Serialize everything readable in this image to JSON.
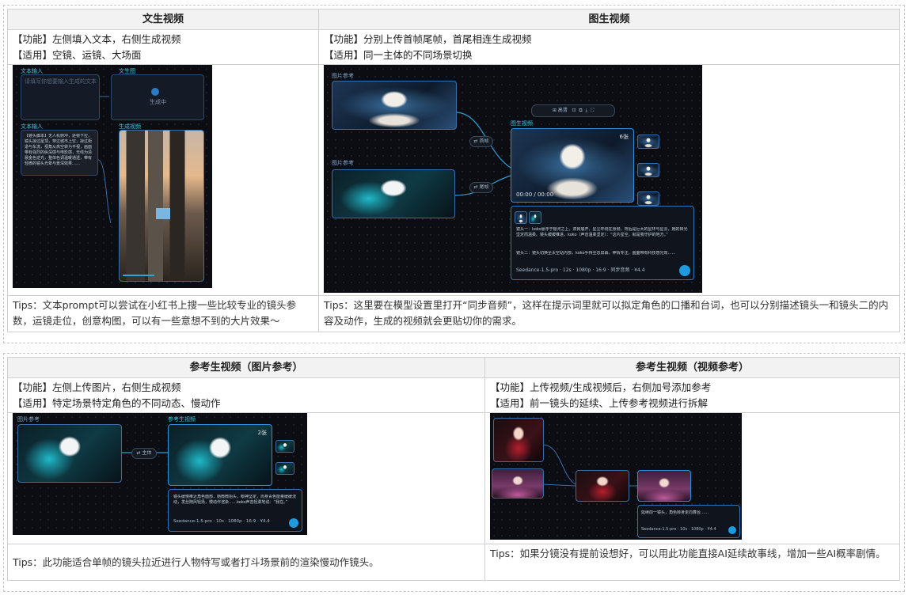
{
  "section1": {
    "left": {
      "title": "文生视频",
      "function_line": "【功能】左侧填入文本，右侧生成视频",
      "usage_line": "【适用】空镜、运镜、大场面",
      "tip": "Tips：文本prompt可以尝试在小红书上搜一些比较专业的镜头参数，运镜走位，创意构图，可以有一些意想不到的大片效果～",
      "shot": {
        "label_text_input": "文本输入",
        "label_text_gen": "文生图",
        "label_text_node": "文本输入",
        "label_video": "生成视频",
        "placeholder": "请填写你想要输入生成的文本",
        "gen_caption": "生成中",
        "prompt_text": "【镜头脚本】无人机俯冲，逐帧下拉，镜头掠过屋顶，穿过城市上空，掠过街道与车流，视角从高空转为平视，画面带有强烈的纵深感与电影感，光线为清晨金色逆光，整体色调温暖通透，带有轻微的镜头光晕与景深效果……"
      }
    },
    "right": {
      "title": "图生视频",
      "function_line": "【功能】分别上传首帧尾帧，首尾相连生成视频",
      "usage_line": "【适用】同一主体的不同场景切换",
      "tip": "Tips：这里要在模型设置里打开“同步音频”，这样在提示词里就可以拟定角色的口播和台词，也可以分别描述镜头一和镜头二的内容及动作，生成的视频就会更贴切你的需求。",
      "shot": {
        "label_ref1": "图片参考",
        "label_ref2": "图片参考",
        "label_video": "图生视频",
        "tag_first": "⇄ 首帧",
        "tag_last": "⇄ 尾帧",
        "toolbar": [
          "⊞ 高清",
          "⊡",
          "⧉",
          "⤓",
          "⛶"
        ],
        "count": "6张",
        "time": "00:00 / 00:00",
        "prompt_1": "镜头一：koko悬浮于银河之上，双臂展开，星尘环绕在身侧，背后是巨大的星环与星云，她的目光坚定而温柔。镜头缓缓推进。koko（声音温柔坚定）：“这片星空，就是我守护的地方。”",
        "prompt_2": "镜头二：镜头切换至太空站内部，koko手持全息屏幕，神情专注，画面带有科技感光效……",
        "model": "Seedance-1.5-pro",
        "duration": "12s",
        "resolution": "1080p",
        "ratio": "16:9",
        "audio": "同步音频",
        "cost": "¥4.4"
      }
    }
  },
  "section2": {
    "left": {
      "title": "参考生视频（图片参考）",
      "function_line": "【功能】左侧上传图片，右侧生成视频",
      "usage_line": "【适用】特定场景特定角色的不同动态、慢动作",
      "tip": "Tips：此功能适合单帧的镜头拉近进行人物特写或者打斗场景前的渲染慢动作镜头。",
      "shot": {
        "label_ref": "图片参考",
        "label_video": "参考生视频",
        "tag_subject": "⇄ 主体",
        "count": "2张",
        "prompt": "镜头缓慢推近角色面部，她微微抬头，眼神坚定，周身青色能量缓缓流动，发丝随风轻扬，慢动作渲染……koko声音轻柔地说：“我在。”",
        "model": "Seedance-1.5-pro",
        "duration": "10s",
        "resolution": "1080p",
        "ratio": "16:9",
        "cost": "¥4.4"
      }
    },
    "right": {
      "title": "参考生视频（视频参考）",
      "function_line": "【功能】上传视频/生成视频后，右侧加号添加参考",
      "usage_line": "【适用】前一镜头的延续、上传参考视频进行拆解",
      "tip": "Tips：如果分镜没有提前设想好，可以用此功能直接AI延续故事线，增加一些AI概率剧情。",
      "shot": {
        "prompt": "延续前一镜头，角色转身走向舞台……",
        "model": "Seedance-1.5-pro",
        "duration": "10s",
        "resolution": "1080p",
        "cost": "¥4.4"
      }
    }
  }
}
